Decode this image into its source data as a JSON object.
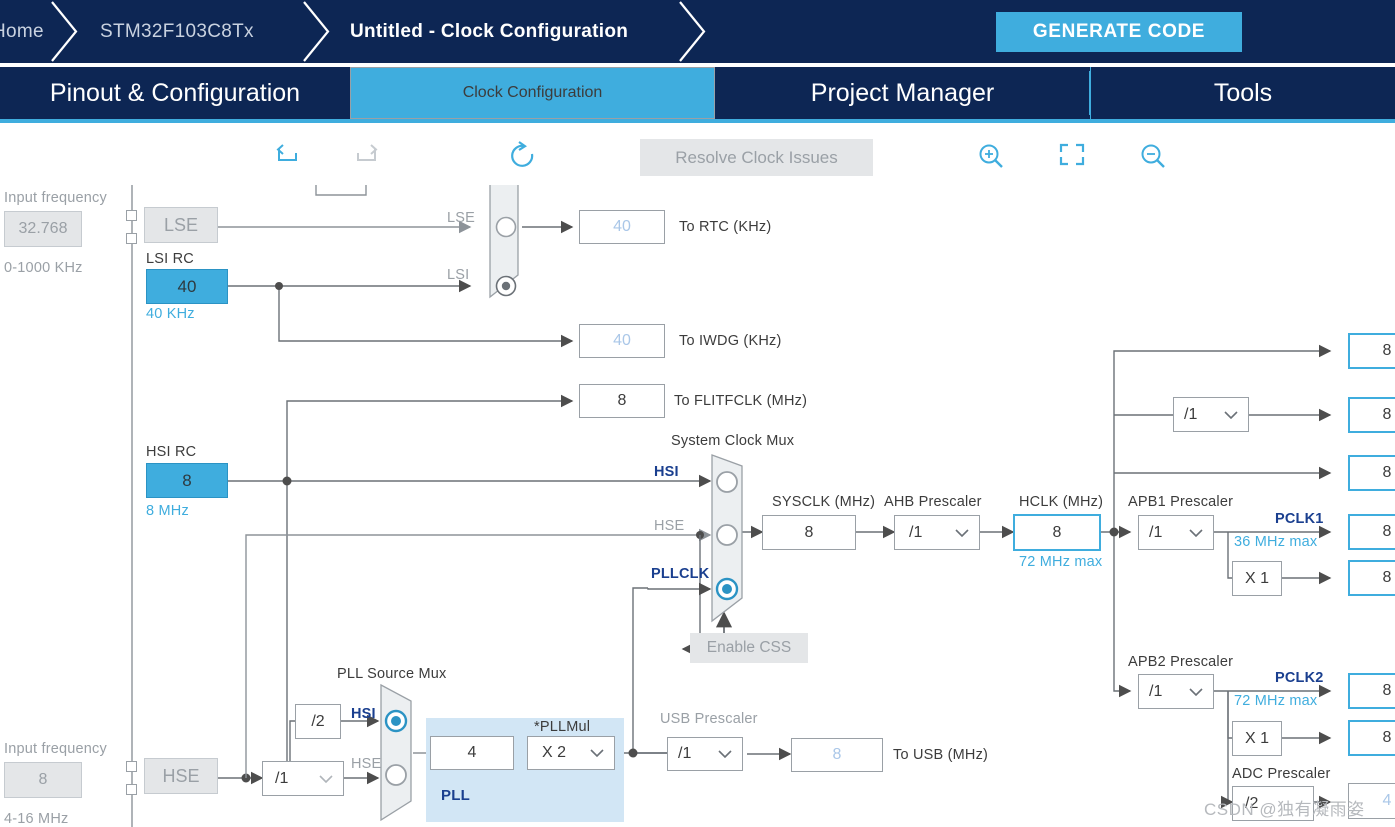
{
  "breadcrumb": {
    "items": [
      {
        "label": "Home",
        "active": false
      },
      {
        "label": "STM32F103C8Tx",
        "active": false
      },
      {
        "label": "Untitled - Clock Configuration",
        "active": true
      }
    ],
    "generate_code_label": "GENERATE CODE",
    "accent": "#3fadde",
    "bar_color": "#0d2654"
  },
  "tabs": [
    {
      "label": "Pinout & Configuration",
      "selected": false
    },
    {
      "label": "Clock Configuration",
      "selected": true
    },
    {
      "label": "Project Manager",
      "selected": false
    },
    {
      "label": "Tools",
      "selected": false
    }
  ],
  "toolbar": {
    "undo_icon": "undo-icon",
    "redo_icon": "redo-icon",
    "reset_icon": "reset-clock-icon",
    "resolve_label": "Resolve Clock Issues",
    "zoom_in_icon": "zoom-in-icon",
    "fit_icon": "fit-to-screen-icon",
    "zoom_out_icon": "zoom-out-icon"
  },
  "diagram": {
    "lse": {
      "input_frequency_label": "Input frequency",
      "input_frequency_value": "32.768",
      "range_label": "0-1000 KHz",
      "block_label": "LSE"
    },
    "lsi": {
      "title": "LSI RC",
      "value": "40",
      "unit_label": "40 KHz"
    },
    "rtc_mux": {
      "input_top_label": "LSE",
      "input_bottom_label": "LSI",
      "selected_index": 1
    },
    "to_rtc": {
      "value": "40",
      "label": "To RTC (KHz)"
    },
    "to_iwdg": {
      "value": "40",
      "label": "To IWDG (KHz)"
    },
    "to_flitfclk": {
      "value": "8",
      "label": "To FLITFCLK (MHz)"
    },
    "hsi": {
      "title": "HSI RC",
      "value": "8",
      "unit_label": "8 MHz"
    },
    "hse": {
      "input_frequency_label": "Input frequency",
      "input_frequency_value": "8",
      "range_label": "4-16 MHz",
      "block_label": "HSE",
      "prescaler_value": "/1"
    },
    "system_clock_mux": {
      "title": "System Clock Mux",
      "inputs": [
        "HSI",
        "HSE",
        "PLLCLK"
      ],
      "selected_index": 2,
      "css_label": "Enable CSS"
    },
    "sysclk": {
      "label": "SYSCLK (MHz)",
      "value": "8"
    },
    "ahb_prescaler": {
      "label": "AHB Prescaler",
      "value": "/1"
    },
    "hclk": {
      "label": "HCLK (MHz)",
      "value": "8",
      "max_label": "72 MHz max"
    },
    "pll": {
      "source_mux_title": "PLL Source Mux",
      "source_inputs": [
        "HSI",
        "HSE"
      ],
      "source_selected_index": 0,
      "hsi_divider": "/2",
      "pll_label": "PLL",
      "pll_input_value": "4",
      "pllmul_label": "*PLLMul",
      "pllmul_value": "X 2"
    },
    "usb": {
      "prescaler_label": "USB Prescaler",
      "prescaler_value": "/1",
      "value": "8",
      "label": "To USB (MHz)"
    },
    "apb1": {
      "title": "APB1 Prescaler",
      "value": "/1",
      "pclk_label": "PCLK1",
      "max_label": "36 MHz max",
      "timer_multiplier": "X 1"
    },
    "apb2": {
      "title": "APB2 Prescaler",
      "value": "/1",
      "pclk_label": "PCLK2",
      "max_label": "72 MHz max",
      "timer_multiplier": "X 1"
    },
    "adc_prescaler": {
      "title": "ADC Prescaler",
      "value": "/2"
    },
    "ahb_top_prescaler": {
      "value": "/1"
    },
    "right_outputs": [
      {
        "value": "8"
      },
      {
        "value": "8"
      },
      {
        "value": "8"
      },
      {
        "value": "8"
      },
      {
        "value": "8"
      },
      {
        "value": "8"
      },
      {
        "value": "8"
      },
      {
        "value": "4"
      }
    ]
  },
  "watermark": "CSDN @独有凝雨姿"
}
